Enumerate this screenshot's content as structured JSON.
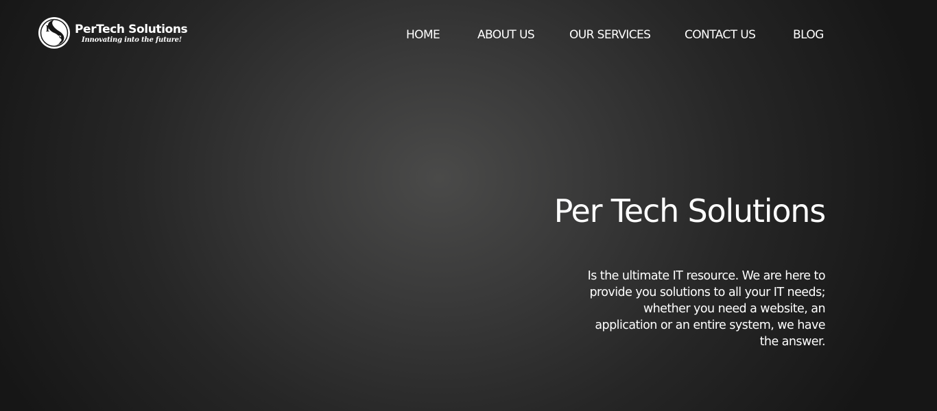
{
  "brand": {
    "name": "PerTech Solutions",
    "tagline": "Innovating into the future!",
    "logo_letters": [
      "P",
      "S"
    ]
  },
  "nav": {
    "items": [
      {
        "label": "HOME"
      },
      {
        "label": "ABOUT US"
      },
      {
        "label": "OUR SERVICES"
      },
      {
        "label": "CONTACT US"
      },
      {
        "label": "BLOG"
      }
    ]
  },
  "hero": {
    "title": "Per Tech Solutions",
    "description_lines": [
      "Is the ultimate IT resource. We are here to",
      "provide you solutions to all your  IT needs;",
      "whether you need a website, an",
      "application or an entire system, we have",
      "the answer."
    ]
  },
  "colors": {
    "text": "#ffffff",
    "background_center": "#4a4a49",
    "background_edge": "#161616"
  }
}
